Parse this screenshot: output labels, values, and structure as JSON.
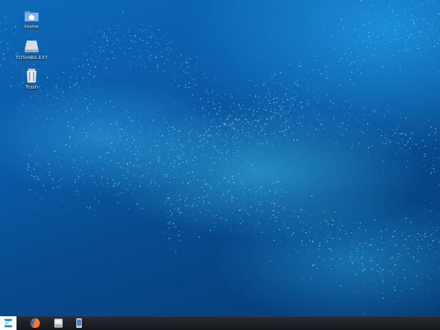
{
  "desktop": {
    "icons": [
      {
        "label": "Home",
        "icon": "home-folder-icon"
      },
      {
        "label": "TOSHIBA EXT",
        "icon": "external-drive-icon"
      },
      {
        "label": "Trash",
        "icon": "trash-icon"
      }
    ]
  },
  "taskbar": {
    "start_icon": "zorin-logo-icon",
    "items": [
      {
        "icon": "firefox-icon"
      },
      {
        "icon": "files-icon"
      },
      {
        "icon": "mobile-device-icon"
      }
    ]
  },
  "colors": {
    "wallpaper_dark": "#053a73",
    "wallpaper_light": "#1e96e1",
    "particle": "#9ee8ff",
    "taskbar": "#1c1f24",
    "accent": "#1d8fe0"
  }
}
